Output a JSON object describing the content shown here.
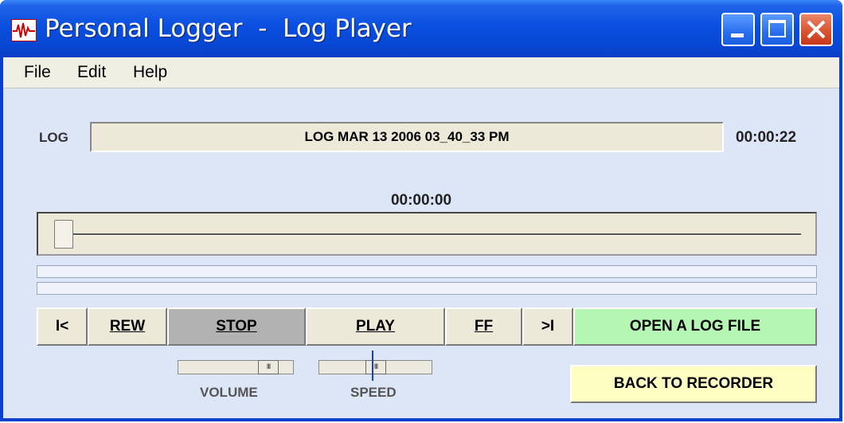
{
  "window": {
    "title": "Personal Logger  -  Log Player",
    "app_icon": "waveform-icon",
    "controls": {
      "minimize": "minimize-icon",
      "maximize": "maximize-icon",
      "close": "close-icon"
    },
    "accent_color": "#0a4fe0",
    "close_color": "#d8512f"
  },
  "menu": {
    "items": [
      "File",
      "Edit",
      "Help"
    ]
  },
  "log": {
    "label": "LOG",
    "file_name": "LOG  MAR 13 2006  03_40_33 PM",
    "duration": "00:00:22"
  },
  "playback": {
    "position_text": "00:00:00",
    "position_fraction": 0.0
  },
  "transport": {
    "first_label": "I<",
    "rew_label": "REW",
    "stop_label": "STOP",
    "play_label": "PLAY",
    "ff_label": "FF",
    "last_label": ">I",
    "open_label": "OPEN A LOG FILE",
    "back_label": "BACK TO RECORDER",
    "colors": {
      "stop": "#b2b2b2",
      "open": "#b5f7b2",
      "back": "#fffec2"
    }
  },
  "volume": {
    "label": "VOLUME",
    "level_fraction": 0.85
  },
  "speed": {
    "label": "SPEED",
    "level_fraction": 0.5
  }
}
